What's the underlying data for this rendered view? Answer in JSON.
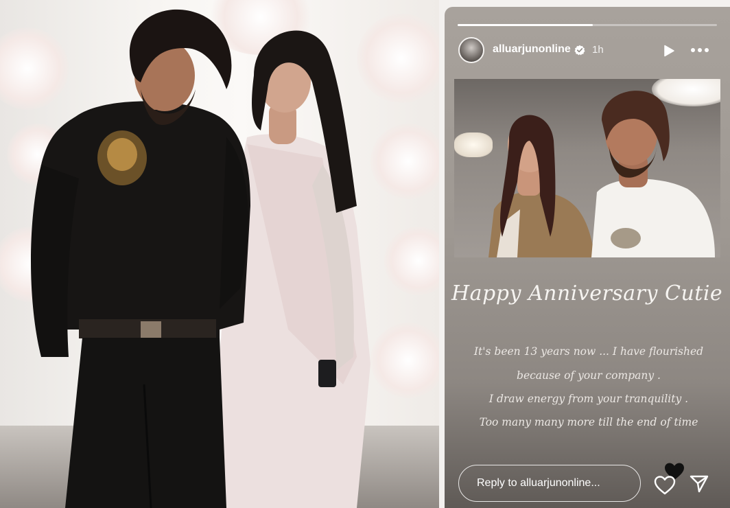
{
  "story": {
    "username": "alluarjunonline",
    "time_ago": "1h",
    "progress_fraction": 0.52,
    "greeting": "Happy Anniversary Cutie",
    "message_lines": [
      "It's been 13 years now ... I have flourished",
      "because of your company .",
      "I draw energy from your tranquility .",
      "Too many many more till the end of time"
    ],
    "reply_placeholder": "Reply to alluarjunonline..."
  },
  "icons": {
    "verified": "verified-badge-icon",
    "play": "play-icon",
    "more": "more-options-icon",
    "like": "heart-outline-icon",
    "sticker": "black-heart-icon",
    "send": "paper-plane-icon"
  },
  "colors": {
    "story_bg": "#9e9892",
    "text": "#ffffff",
    "verified_badge": "#ffffff"
  }
}
